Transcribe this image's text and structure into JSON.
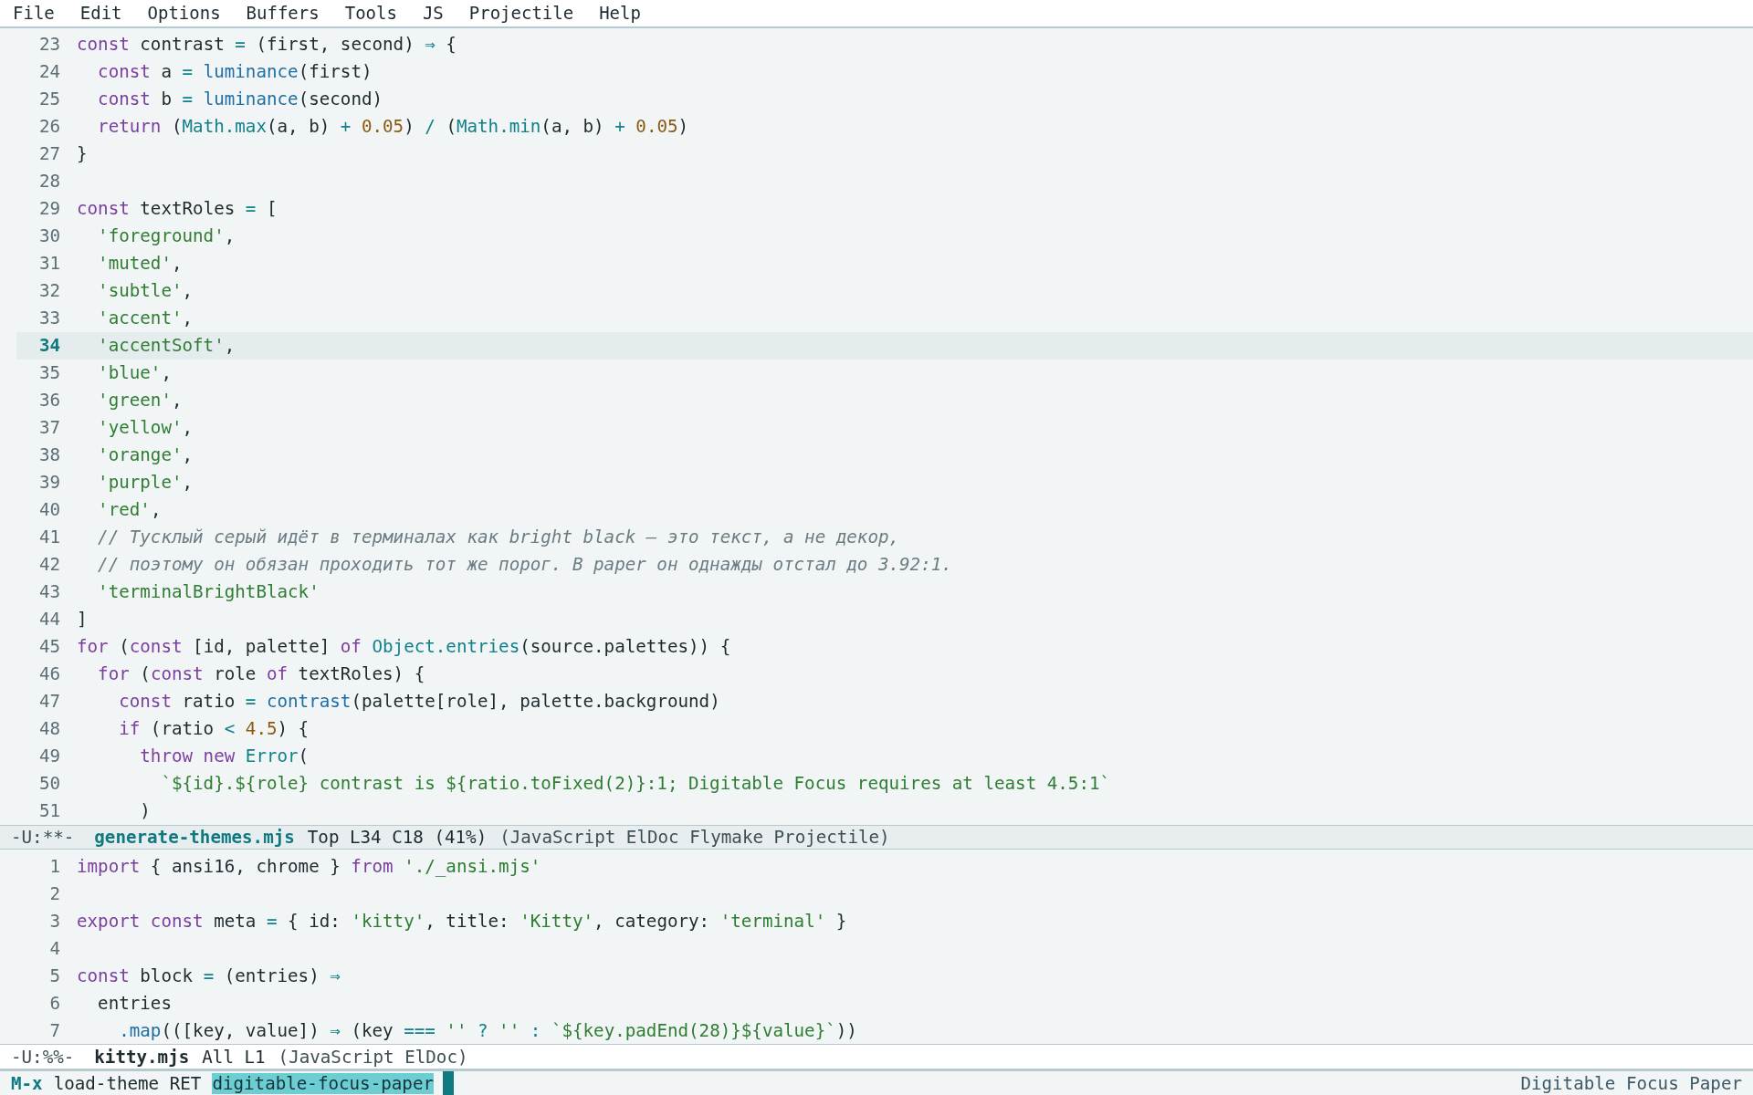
{
  "menu_bar": [
    "File",
    "Edit",
    "Options",
    "Buffers",
    "Tools",
    "JS",
    "Projectile",
    "Help"
  ],
  "top_window": {
    "lines": [
      {
        "number": "23",
        "current": false,
        "tokens": [
          {
            "kind": "keyword",
            "text": "const"
          },
          {
            "kind": "plain",
            "text": " contrast "
          },
          {
            "kind": "operator",
            "text": "="
          },
          {
            "kind": "plain",
            "text": " (first, second) "
          },
          {
            "kind": "operator",
            "text": "⇒"
          },
          {
            "kind": "plain",
            "text": " {"
          }
        ]
      },
      {
        "number": "24",
        "current": false,
        "tokens": [
          {
            "kind": "keyword",
            "text": "  const"
          },
          {
            "kind": "plain",
            "text": " a "
          },
          {
            "kind": "operator",
            "text": "="
          },
          {
            "kind": "function",
            "text": " luminance"
          },
          {
            "kind": "plain",
            "text": "(first)"
          }
        ]
      },
      {
        "number": "25",
        "current": false,
        "tokens": [
          {
            "kind": "keyword",
            "text": "  const"
          },
          {
            "kind": "plain",
            "text": " b "
          },
          {
            "kind": "operator",
            "text": "="
          },
          {
            "kind": "function",
            "text": " luminance"
          },
          {
            "kind": "plain",
            "text": "(second)"
          }
        ]
      },
      {
        "number": "26",
        "current": false,
        "tokens": [
          {
            "kind": "keyword",
            "text": "  return"
          },
          {
            "kind": "plain",
            "text": " ("
          },
          {
            "kind": "builtin",
            "text": "Math.max"
          },
          {
            "kind": "plain",
            "text": "(a, b) "
          },
          {
            "kind": "operator",
            "text": "+"
          },
          {
            "kind": "number",
            "text": " 0.05"
          },
          {
            "kind": "plain",
            "text": ") "
          },
          {
            "kind": "operator",
            "text": "/"
          },
          {
            "kind": "plain",
            "text": " ("
          },
          {
            "kind": "builtin",
            "text": "Math.min"
          },
          {
            "kind": "plain",
            "text": "(a, b) "
          },
          {
            "kind": "operator",
            "text": "+"
          },
          {
            "kind": "number",
            "text": " 0.05"
          },
          {
            "kind": "plain",
            "text": ")"
          }
        ]
      },
      {
        "number": "27",
        "current": false,
        "tokens": [
          {
            "kind": "plain",
            "text": "}"
          }
        ]
      },
      {
        "number": "28",
        "current": false
      },
      {
        "number": "29",
        "current": false,
        "tokens": [
          {
            "kind": "keyword",
            "text": "const"
          },
          {
            "kind": "plain",
            "text": " textRoles "
          },
          {
            "kind": "operator",
            "text": "="
          },
          {
            "kind": "plain",
            "text": " ["
          }
        ]
      },
      {
        "number": "30",
        "current": false,
        "tokens": [
          {
            "kind": "string",
            "text": "  'foreground'"
          },
          {
            "kind": "plain",
            "text": ","
          }
        ]
      },
      {
        "number": "31",
        "current": false,
        "tokens": [
          {
            "kind": "string",
            "text": "  'muted'"
          },
          {
            "kind": "plain",
            "text": ","
          }
        ]
      },
      {
        "number": "32",
        "current": false,
        "tokens": [
          {
            "kind": "string",
            "text": "  'subtle'"
          },
          {
            "kind": "plain",
            "text": ","
          }
        ]
      },
      {
        "number": "33",
        "current": false,
        "tokens": [
          {
            "kind": "string",
            "text": "  'accent'"
          },
          {
            "kind": "plain",
            "text": ","
          }
        ]
      },
      {
        "number": "34",
        "current": true,
        "tokens": [
          {
            "kind": "string",
            "text": "  'accentSoft'"
          },
          {
            "kind": "plain",
            "text": ","
          }
        ]
      },
      {
        "number": "35",
        "current": false,
        "tokens": [
          {
            "kind": "string",
            "text": "  'blue'"
          },
          {
            "kind": "plain",
            "text": ","
          }
        ]
      },
      {
        "number": "36",
        "current": false,
        "tokens": [
          {
            "kind": "string",
            "text": "  'green'"
          },
          {
            "kind": "plain",
            "text": ","
          }
        ]
      },
      {
        "number": "37",
        "current": false,
        "tokens": [
          {
            "kind": "string",
            "text": "  'yellow'"
          },
          {
            "kind": "plain",
            "text": ","
          }
        ]
      },
      {
        "number": "38",
        "current": false,
        "tokens": [
          {
            "kind": "string",
            "text": "  'orange'"
          },
          {
            "kind": "plain",
            "text": ","
          }
        ]
      },
      {
        "number": "39",
        "current": false,
        "tokens": [
          {
            "kind": "string",
            "text": "  'purple'"
          },
          {
            "kind": "plain",
            "text": ","
          }
        ]
      },
      {
        "number": "40",
        "current": false,
        "tokens": [
          {
            "kind": "string",
            "text": "  'red'"
          },
          {
            "kind": "plain",
            "text": ","
          }
        ]
      },
      {
        "number": "41",
        "current": false,
        "tokens": [
          {
            "kind": "comment",
            "text": "  // Тусклый серый идёт в терминалах как bright black — это текст, а не декор,"
          }
        ]
      },
      {
        "number": "42",
        "current": false,
        "tokens": [
          {
            "kind": "comment",
            "text": "  // поэтому он обязан проходить тот же порог. В paper он однажды отстал до 3.92:1."
          }
        ]
      },
      {
        "number": "43",
        "current": false,
        "tokens": [
          {
            "kind": "string",
            "text": "  'terminalBrightBlack'"
          }
        ]
      },
      {
        "number": "44",
        "current": false,
        "tokens": [
          {
            "kind": "plain",
            "text": "]"
          }
        ]
      },
      {
        "number": "45",
        "current": false,
        "tokens": [
          {
            "kind": "keyword",
            "text": "for"
          },
          {
            "kind": "plain",
            "text": " ("
          },
          {
            "kind": "keyword",
            "text": "const"
          },
          {
            "kind": "plain",
            "text": " [id, palette] "
          },
          {
            "kind": "keyword",
            "text": "of"
          },
          {
            "kind": "builtin",
            "text": " Object.entries"
          },
          {
            "kind": "plain",
            "text": "(source.palettes)) {"
          }
        ]
      },
      {
        "number": "46",
        "current": false,
        "tokens": [
          {
            "kind": "keyword",
            "text": "  for"
          },
          {
            "kind": "plain",
            "text": " ("
          },
          {
            "kind": "keyword",
            "text": "const"
          },
          {
            "kind": "plain",
            "text": " role "
          },
          {
            "kind": "keyword",
            "text": "of"
          },
          {
            "kind": "plain",
            "text": " textRoles) {"
          }
        ]
      },
      {
        "number": "47",
        "current": false,
        "tokens": [
          {
            "kind": "keyword",
            "text": "    const"
          },
          {
            "kind": "plain",
            "text": " ratio "
          },
          {
            "kind": "operator",
            "text": "="
          },
          {
            "kind": "function",
            "text": " contrast"
          },
          {
            "kind": "plain",
            "text": "(palette[role], palette.background)"
          }
        ]
      },
      {
        "number": "48",
        "current": false,
        "tokens": [
          {
            "kind": "keyword",
            "text": "    if"
          },
          {
            "kind": "plain",
            "text": " (ratio "
          },
          {
            "kind": "operator",
            "text": "<"
          },
          {
            "kind": "number",
            "text": " 4.5"
          },
          {
            "kind": "plain",
            "text": ") {"
          }
        ]
      },
      {
        "number": "49",
        "current": false,
        "tokens": [
          {
            "kind": "keyword",
            "text": "      throw new"
          },
          {
            "kind": "builtin",
            "text": " Error"
          },
          {
            "kind": "plain",
            "text": "("
          }
        ]
      },
      {
        "number": "50",
        "current": false,
        "tokens": [
          {
            "kind": "string",
            "text": "        `${id}.${role} contrast is ${ratio.toFixed(2)}:1; Digitable Focus requires at least 4.5:1`"
          }
        ]
      },
      {
        "number": "51",
        "current": false,
        "tokens": [
          {
            "kind": "plain",
            "text": "      )"
          }
        ]
      }
    ]
  },
  "top_mode_line": {
    "active": true,
    "status": "-U:**-",
    "buffer": "generate-themes.mjs",
    "position": "Top L34 C18 (41%)",
    "modes": "(JavaScript ElDoc Flymake Projectile)"
  },
  "bottom_window": {
    "lines": [
      {
        "number": "1",
        "current": false,
        "tokens": [
          {
            "kind": "keyword",
            "text": "import"
          },
          {
            "kind": "plain",
            "text": " { ansi16, chrome } "
          },
          {
            "kind": "keyword",
            "text": "from"
          },
          {
            "kind": "string",
            "text": " './_ansi.mjs'"
          }
        ]
      },
      {
        "number": "2",
        "current": false
      },
      {
        "number": "3",
        "current": false,
        "tokens": [
          {
            "kind": "keyword",
            "text": "export const"
          },
          {
            "kind": "plain",
            "text": " meta "
          },
          {
            "kind": "operator",
            "text": "="
          },
          {
            "kind": "plain",
            "text": " { id: "
          },
          {
            "kind": "string",
            "text": "'kitty'"
          },
          {
            "kind": "plain",
            "text": ", title: "
          },
          {
            "kind": "string",
            "text": "'Kitty'"
          },
          {
            "kind": "plain",
            "text": ", category: "
          },
          {
            "kind": "string",
            "text": "'terminal'"
          },
          {
            "kind": "plain",
            "text": " }"
          }
        ]
      },
      {
        "number": "4",
        "current": false
      },
      {
        "number": "5",
        "current": false,
        "tokens": [
          {
            "kind": "keyword",
            "text": "const"
          },
          {
            "kind": "plain",
            "text": " block "
          },
          {
            "kind": "operator",
            "text": "="
          },
          {
            "kind": "plain",
            "text": " (entries) "
          },
          {
            "kind": "operator",
            "text": "⇒"
          }
        ]
      },
      {
        "number": "6",
        "current": false,
        "tokens": [
          {
            "kind": "plain",
            "text": "  entries"
          }
        ]
      },
      {
        "number": "7",
        "current": false,
        "tokens": [
          {
            "kind": "function",
            "text": "    .map"
          },
          {
            "kind": "plain",
            "text": "(([key, value]) "
          },
          {
            "kind": "operator",
            "text": "⇒"
          },
          {
            "kind": "plain",
            "text": " (key "
          },
          {
            "kind": "operator",
            "text": "==="
          },
          {
            "kind": "string",
            "text": " ''"
          },
          {
            "kind": "operator",
            "text": " ?"
          },
          {
            "kind": "string",
            "text": " ''"
          },
          {
            "kind": "operator",
            "text": " :"
          },
          {
            "kind": "string",
            "text": " `${key.padEnd(28)}${value}`"
          },
          {
            "kind": "plain",
            "text": "))"
          }
        ]
      }
    ]
  },
  "bottom_mode_line": {
    "active": false,
    "status": "-U:%%-",
    "buffer": "kitty.mjs",
    "position": "All L1",
    "modes": "(JavaScript ElDoc)"
  },
  "minibuffer": {
    "prompt": "M-x",
    "command": "load-theme RET",
    "input": "digitable-focus-paper",
    "message": "Digitable Focus Paper"
  }
}
